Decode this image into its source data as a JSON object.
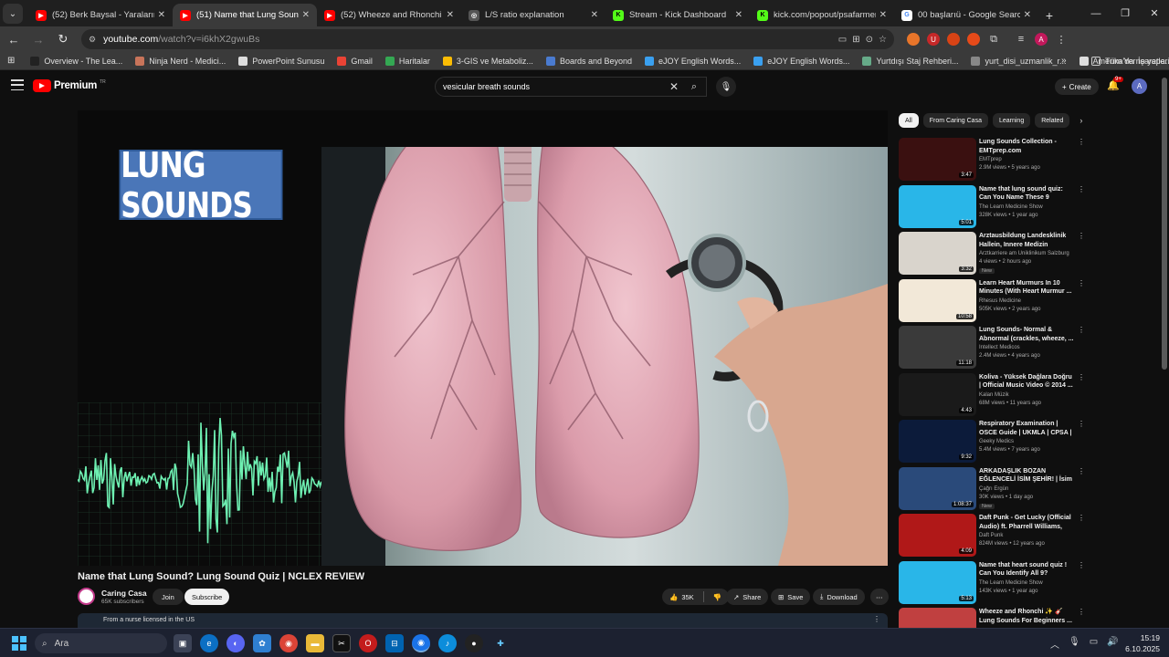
{
  "tabs": [
    {
      "title": "(52) Berk Baysal - Yaralarını Ben",
      "favicon": "youtube-icon",
      "active": false
    },
    {
      "title": "(51) Name that Lung Sound? Lu",
      "favicon": "youtube-icon",
      "active": true
    },
    {
      "title": "(52) Wheeze and Rhonchi ✨ 🎸",
      "favicon": "youtube-icon",
      "active": false
    },
    {
      "title": "L/S ratio explanation",
      "favicon": "openai-icon",
      "active": false
    },
    {
      "title": "Stream - Kick Dashboard",
      "favicon": "kick-icon",
      "active": false
    },
    {
      "title": "kick.com/popout/psafarmer/ch",
      "favicon": "kick-icon",
      "active": false
    },
    {
      "title": "00 başlarıü - Google Search",
      "favicon": "google-icon",
      "active": false
    }
  ],
  "address": {
    "host": "youtube.com",
    "path": "/watch?v=i6khX2gwuBs"
  },
  "bookmarks": [
    {
      "label": "Overview - The Lea...",
      "color": "#222"
    },
    {
      "label": "Ninja Nerd - Medici...",
      "color": "#c8745a"
    },
    {
      "label": "PowerPoint Sunusu",
      "color": "#ddd"
    },
    {
      "label": "Gmail",
      "color": "#ea4335"
    },
    {
      "label": "Haritalar",
      "color": "#34a853"
    },
    {
      "label": "3-GIS ve Metaboliz...",
      "color": "#fbbc04"
    },
    {
      "label": "Boards and Beyond",
      "color": "#4a7bd0"
    },
    {
      "label": "eJOY English Words...",
      "color": "#3aa0f0"
    },
    {
      "label": "eJOY English Words...",
      "color": "#3aa0f0"
    },
    {
      "label": "Yurtdışı Staj Rehberi...",
      "color": "#6a8"
    },
    {
      "label": "yurt_disi_uzmanlik_r...",
      "color": "#888"
    },
    {
      "label": "Amerika'da ne yapa...",
      "color": "#ddd"
    }
  ],
  "bookmarks_more": "»",
  "bookmarks_all": "Tüm Yer İşaretleri",
  "yt": {
    "brand": "Premium",
    "region": "TR",
    "search_query": "vesicular breath sounds",
    "create_label": "Create",
    "notif_count": "9+",
    "avatar_letter": "A"
  },
  "video": {
    "overlay_text": "LUNG SOUNDS",
    "title": "Name that Lung Sound? Lung Sound Quiz | NCLEX REVIEW",
    "channel": "Caring Casa",
    "subscribers": "65K subscribers",
    "join_label": "Join",
    "subscribe_label": "Subscribe",
    "likes": "35K",
    "share_label": "Share",
    "save_label": "Save",
    "download_label": "Download",
    "description_preview": "From a nurse licensed in the US"
  },
  "chips": [
    "All",
    "From Caring Casa",
    "Learning",
    "Related"
  ],
  "related": [
    {
      "title": "Lung Sounds Collection - EMTprep.com",
      "channel": "EMTprep",
      "meta": "2.9M views • 5 years ago",
      "duration": "3:47",
      "new": "",
      "thumb": "#3a1010"
    },
    {
      "title": "Name that lung sound quiz: Can You Name These 9 Common ...",
      "channel": "The Learn Medicine Show",
      "meta": "328K views • 1 year ago",
      "duration": "5:01",
      "new": "",
      "thumb": "#29b6e8"
    },
    {
      "title": "Arztausbildung Landesklinik Hallein, Innere Medizin",
      "channel": "Arztkarriere am Uniklinikum Salzburg",
      "meta": "4 views • 2 hours ago",
      "duration": "3:32",
      "new": "New",
      "thumb": "#d9d4cc"
    },
    {
      "title": "Learn Heart Murmurs In 10 Minutes (With Heart Murmur ...",
      "channel": "Rhesus Medicine",
      "meta": "505K views • 2 years ago",
      "duration": "10:58",
      "new": "",
      "thumb": "#f2e8d8"
    },
    {
      "title": "Lung Sounds- Normal & Abnormal (crackles, wheeze, ...",
      "channel": "Intellect Medicos",
      "meta": "2.4M views • 4 years ago",
      "duration": "11:18",
      "new": "",
      "thumb": "#3a3a3a"
    },
    {
      "title": "Koliva - Yüksek Dağlara Doğru | Official Music Video © 2014 ...",
      "channel": "Kalan Müzik",
      "meta": "68M views • 11 years ago",
      "duration": "4:43",
      "new": "",
      "thumb": "#1a1a1a"
    },
    {
      "title": "Respiratory Examination | OSCE Guide | UKMLA | CPSA | PLAB 2",
      "channel": "Geeky Medics",
      "meta": "5.4M views • 7 years ago",
      "duration": "9:32",
      "new": "",
      "thumb": "#0c1b3a"
    },
    {
      "title": "ARKADAŞLIK BOZAN EĞLENCELİ İSİM ŞEHİR! | İsim ...",
      "channel": "Çağrı Ergün",
      "meta": "30K views • 1 day ago",
      "duration": "1:08:37",
      "new": "New",
      "thumb": "#2a4a7a"
    },
    {
      "title": "Daft Punk - Get Lucky (Official Audio) ft. Pharrell Williams, Nil...",
      "channel": "Daft Punk",
      "meta": "824M views • 12 years ago",
      "duration": "4:09",
      "new": "",
      "thumb": "#b01818"
    },
    {
      "title": "Name that heart sound quiz ! Can You Identify All 9?",
      "channel": "The Learn Medicine Show",
      "meta": "143K views • 1 year ago",
      "duration": "5:13",
      "new": "",
      "thumb": "#29b6e8"
    },
    {
      "title": "Wheeze and Rhonchi ✨ 🎸 Lung Sounds For Beginners ...",
      "channel": "",
      "meta": "",
      "duration": "",
      "new": "",
      "thumb": "#c04040"
    }
  ],
  "taskbar": {
    "search_placeholder": "Ara",
    "time": "15:19",
    "date": "6.10.2025"
  }
}
